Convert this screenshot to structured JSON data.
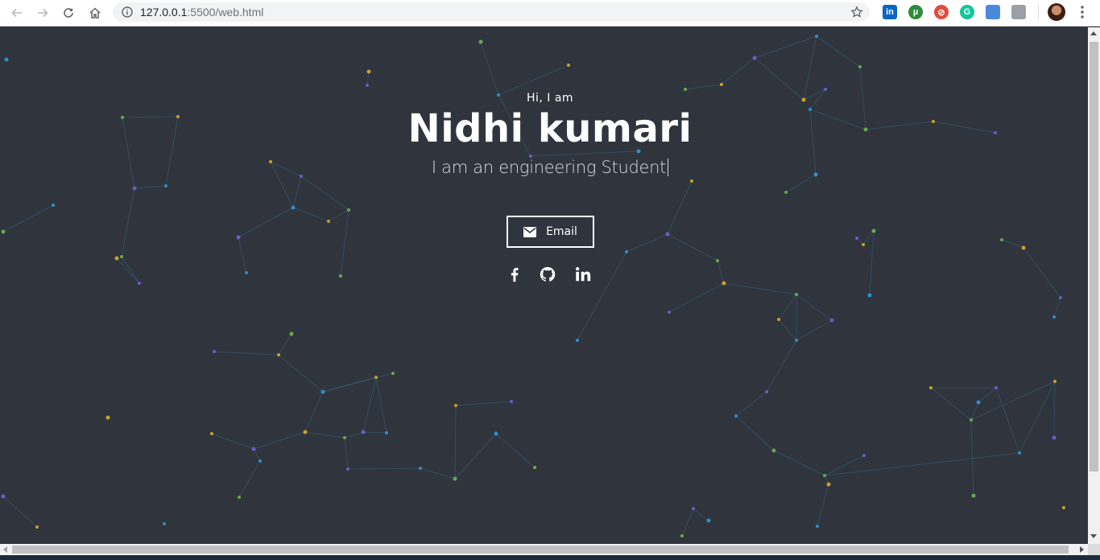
{
  "browser": {
    "url_host": "127.0.0.1",
    "url_path": ":5500/web.html",
    "extensions": [
      {
        "name": "linkedin",
        "label": "in",
        "color": "#0a66c2"
      },
      {
        "name": "utorrent",
        "label": "µ",
        "color": "#2e8b3a"
      },
      {
        "name": "blocker",
        "label": "⊘",
        "color": "#e34b3c"
      },
      {
        "name": "grammarly",
        "label": "G",
        "color": "#15c39a"
      },
      {
        "name": "extension-5",
        "label": "",
        "color": "#4a89dc"
      },
      {
        "name": "extension-6",
        "label": "",
        "color": "#9aa0a6"
      }
    ]
  },
  "hero": {
    "greeting": "Hi, I am",
    "name": "Nidhi kumari",
    "tagline": "I am an engineering Student",
    "email_label": "Email"
  },
  "socials": [
    {
      "name": "facebook-icon"
    },
    {
      "name": "github-icon"
    },
    {
      "name": "linkedin-icon"
    }
  ],
  "colors": {
    "background": "#2f343d",
    "text": "#ffffff",
    "particle_blue": "#2f8fc9",
    "particle_green": "#6aa84f",
    "particle_gold": "#c9a227",
    "particle_purple": "#6b5bc9"
  }
}
